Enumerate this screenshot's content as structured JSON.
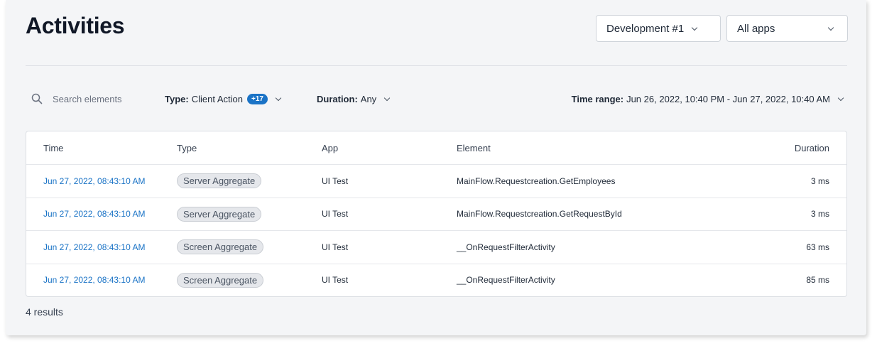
{
  "header": {
    "title": "Activities",
    "environment_select": "Development #1",
    "app_select": "All apps"
  },
  "filters": {
    "search_placeholder": "Search elements",
    "type": {
      "label": "Type:",
      "value": "Client Action",
      "badge": "+17"
    },
    "duration": {
      "label": "Duration:",
      "value": "Any"
    },
    "time_range": {
      "label": "Time range:",
      "value": "Jun 26, 2022, 10:40 PM - Jun 27, 2022, 10:40 AM"
    }
  },
  "table": {
    "columns": [
      "Time",
      "Type",
      "App",
      "Element",
      "Duration"
    ],
    "rows": [
      {
        "time": "Jun 27, 2022, 08:43:10 AM",
        "type": "Server Aggregate",
        "app": "UI Test",
        "element": "MainFlow.Requestcreation.GetEmployees",
        "duration": "3 ms"
      },
      {
        "time": "Jun 27, 2022, 08:43:10 AM",
        "type": "Server Aggregate",
        "app": "UI Test",
        "element": "MainFlow.Requestcreation.GetRequestById",
        "duration": "3 ms"
      },
      {
        "time": "Jun 27, 2022, 08:43:10 AM",
        "type": "Screen Aggregate",
        "app": "UI Test",
        "element": "__OnRequestFilterActivity",
        "duration": "63 ms"
      },
      {
        "time": "Jun 27, 2022, 08:43:10 AM",
        "type": "Screen Aggregate",
        "app": "UI Test",
        "element": "__OnRequestFilterActivity",
        "duration": "85 ms"
      }
    ]
  },
  "footer": {
    "results": "4 results"
  },
  "colors": {
    "panel_background": "#f4f5f7",
    "link": "#1a73c6",
    "badge": "#1a73c6"
  }
}
